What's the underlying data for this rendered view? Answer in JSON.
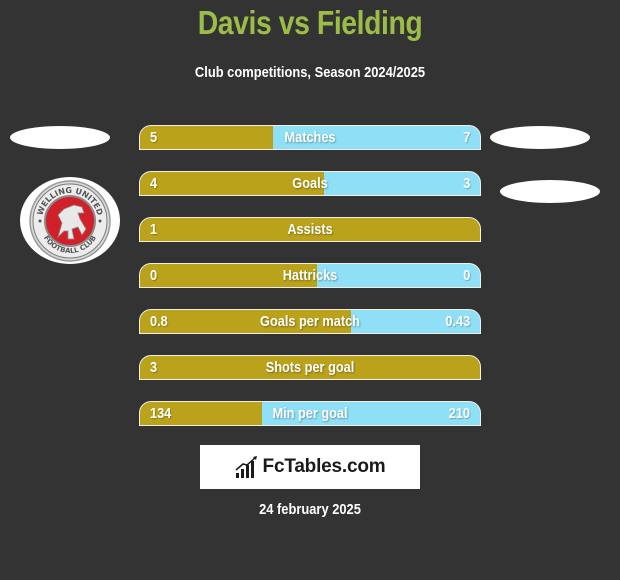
{
  "header": {
    "title": "Davis vs Fielding",
    "subtitle": "Club competitions, Season 2024/2025"
  },
  "colors": {
    "background": "#333333",
    "title": "#9bbd47",
    "left_bar": "#baa31a",
    "right_bar": "#8fe0f7"
  },
  "left_team": {
    "badge_name": "Welling United Football Club",
    "badge_text_top": "WELLING UNITED",
    "badge_text_bottom": "FOOTBALL CLUB"
  },
  "stats": [
    {
      "label": "Matches",
      "left": "5",
      "right": "7",
      "left_share": 0.39
    },
    {
      "label": "Goals",
      "left": "4",
      "right": "3",
      "left_share": 0.54
    },
    {
      "label": "Assists",
      "left": "1",
      "right": "",
      "left_share": 1.0
    },
    {
      "label": "Hattricks",
      "left": "0",
      "right": "0",
      "left_share": 0.52
    },
    {
      "label": "Goals per match",
      "left": "0.8",
      "right": "0.43",
      "left_share": 0.62
    },
    {
      "label": "Shots per goal",
      "left": "3",
      "right": "",
      "left_share": 1.0
    },
    {
      "label": "Min per goal",
      "left": "134",
      "right": "210",
      "left_share": 0.36
    }
  ],
  "footer": {
    "logo_text": "FcTables.com",
    "date": "24 february 2025"
  }
}
